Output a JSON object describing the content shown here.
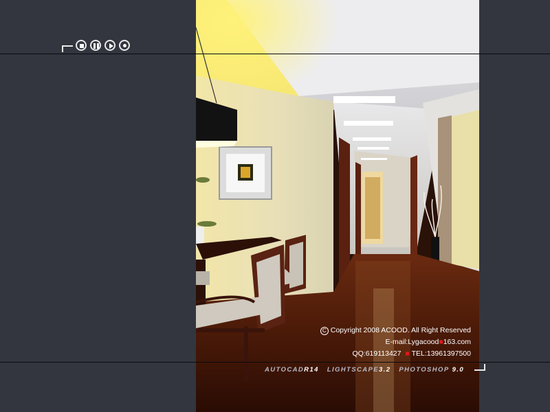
{
  "controls": {
    "buttons": [
      {
        "name": "stop-button",
        "icon": "stop-icon"
      },
      {
        "name": "pause-button",
        "icon": "pause-icon"
      },
      {
        "name": "play-button",
        "icon": "play-icon"
      },
      {
        "name": "record-button",
        "icon": "record-icon"
      }
    ]
  },
  "credits": {
    "copyright_symbol": "C",
    "copyright": "Copyright 2008 ACOOD.  All  Right  Reserved",
    "email_prefix": "E-mail:Lygacood",
    "email_suffix": "163.com",
    "qq": "QQ:619113427",
    "tel": "TEL:13961397500"
  },
  "software": {
    "items": [
      {
        "name": "AUTOCAD",
        "version": "R14"
      },
      {
        "name": "LIGHTSCAPE",
        "version": "3.2"
      },
      {
        "name": "PHOTOSHOP",
        "version": "9.0"
      }
    ]
  },
  "colors": {
    "background": "#33363f",
    "accent_red": "#e01818",
    "text": "#ffffff",
    "software_label": "#b7b9c2"
  }
}
